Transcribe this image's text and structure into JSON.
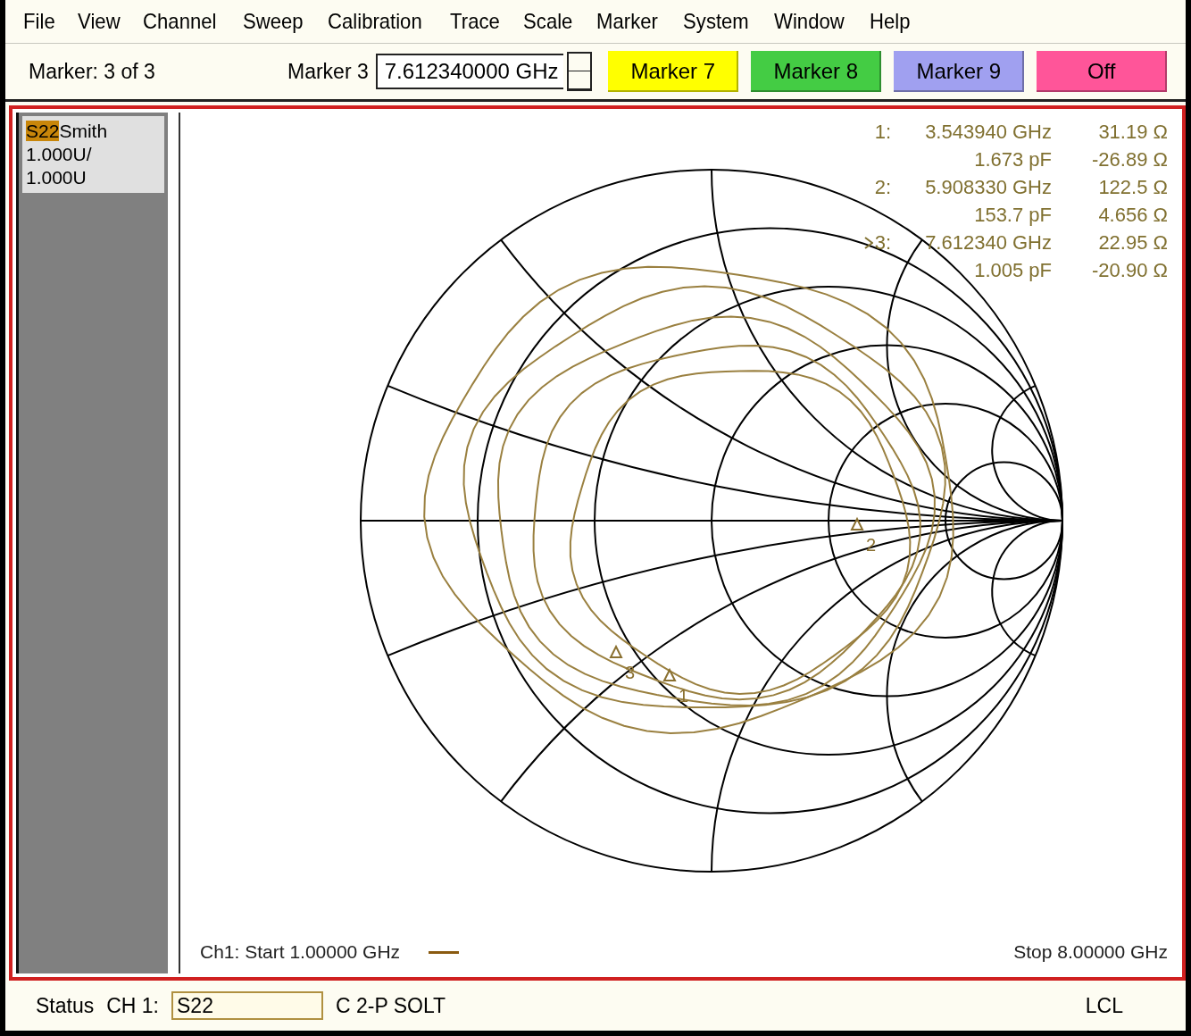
{
  "menu": [
    "File",
    "View",
    "Channel",
    "Sweep",
    "Calibration",
    "Trace",
    "Scale",
    "Marker",
    "System",
    "Window",
    "Help"
  ],
  "toolbar": {
    "marker_count": "Marker: 3 of 3",
    "marker_field": {
      "label": "Marker 3",
      "value": "7.612340000 GHz"
    },
    "buttons": [
      {
        "label": "Marker 7",
        "color": "#ffff00"
      },
      {
        "label": "Marker 8",
        "color": "#44cc44"
      },
      {
        "label": "Marker 9",
        "color": "#a0a0f0"
      },
      {
        "label": "Off",
        "color": "#ff5599"
      }
    ]
  },
  "trace_panel": {
    "tag": "S22",
    "title": "Smith",
    "scale_lines": [
      "1.000U/",
      "1.000U"
    ]
  },
  "chart": {
    "readouts": [
      {
        "marker": "1:",
        "selected": false,
        "lines": [
          {
            "value": "3.543940 GHz",
            "impedance": "31.19 Ω"
          },
          {
            "value": "1.673 pF",
            "impedance": "-26.89 Ω"
          }
        ]
      },
      {
        "marker": "2:",
        "selected": false,
        "lines": [
          {
            "value": "5.908330 GHz",
            "impedance": "122.5 Ω"
          },
          {
            "value": "153.7 pF",
            "impedance": "4.656 Ω"
          }
        ]
      },
      {
        "marker": "3:",
        "selected": true,
        "lines": [
          {
            "value": "7.612340 GHz",
            "impedance": "22.95 Ω"
          },
          {
            "value": "1.005 pF",
            "impedance": "-20.90 Ω"
          }
        ]
      }
    ],
    "trace_markers": [
      {
        "label": "1"
      },
      {
        "label": "2"
      },
      {
        "label": "3"
      }
    ],
    "start": "Ch1: Start  1.00000 GHz",
    "stop": "Stop  8.00000 GHz"
  },
  "status_bar": {
    "label": "Status",
    "channel": "CH 1:",
    "parameter": "S22",
    "calibration": "C  2-P SOLT",
    "mode": "LCL"
  }
}
